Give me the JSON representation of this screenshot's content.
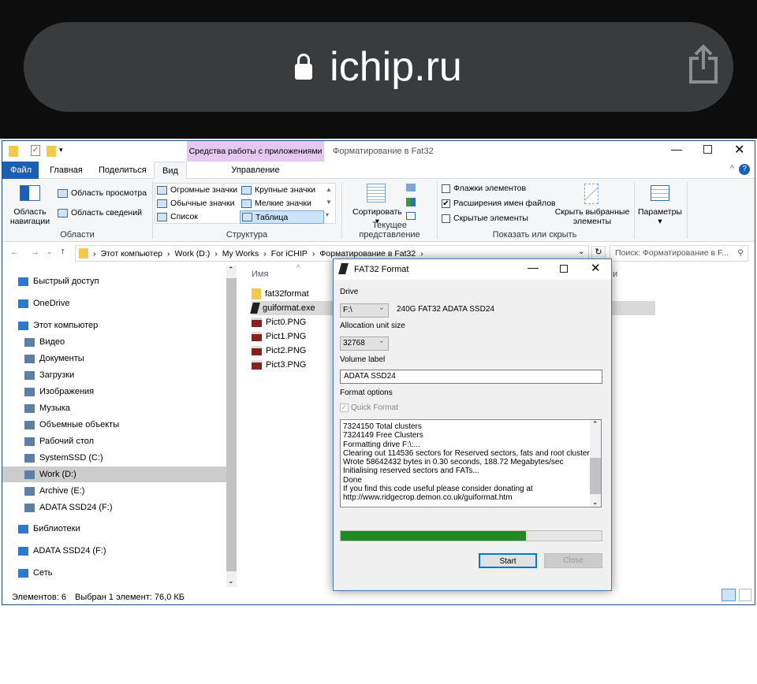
{
  "browser": {
    "domain": "ichip.ru",
    "icons": [
      "lock-icon",
      "share-icon"
    ]
  },
  "explorer": {
    "window_title": "Форматирование в Fat32",
    "context_tab_group": "Средства работы с приложениями",
    "tabs": [
      "Файл",
      "Главная",
      "Поделиться",
      "Вид",
      "Управление"
    ],
    "ribbon": {
      "areas": {
        "nav_pane": "Область навигации",
        "preview": "Область просмотра",
        "details": "Область сведений",
        "group": "Области"
      },
      "layout": {
        "items": [
          "Огромные значки",
          "Крупные значки",
          "Обычные значки",
          "Мелкие значки",
          "Список",
          "Таблица"
        ],
        "selected": "Таблица",
        "group": "Структура"
      },
      "current_view": {
        "sort": "Сортировать",
        "group": "Текущее представление"
      },
      "show_hide": {
        "checkboxes": [
          {
            "label": "Флажки элементов",
            "checked": false
          },
          {
            "label": "Расширения имен файлов",
            "checked": true
          },
          {
            "label": "Скрытые элементы",
            "checked": false
          }
        ],
        "hide_selected": "Скрыть выбранные элементы",
        "group": "Показать или скрыть"
      },
      "options": "Параметры"
    },
    "breadcrumb": [
      "Этот компьютер",
      "Work (D:)",
      "My Works",
      "For iCHIP",
      "Форматирование в Fat32"
    ],
    "search_placeholder": "Поиск: Форматирование в F...",
    "nav": [
      {
        "label": "Быстрый доступ",
        "level": 0
      },
      {
        "label": "OneDrive",
        "level": 0
      },
      {
        "label": "Этот компьютер",
        "level": 0
      },
      {
        "label": "Видео",
        "level": 1
      },
      {
        "label": "Документы",
        "level": 1
      },
      {
        "label": "Загрузки",
        "level": 1
      },
      {
        "label": "Изображения",
        "level": 1
      },
      {
        "label": "Музыка",
        "level": 1
      },
      {
        "label": "Объемные объекты",
        "level": 1
      },
      {
        "label": "Рабочий стол",
        "level": 1
      },
      {
        "label": "SystemSSD (C:)",
        "level": 1
      },
      {
        "label": "Work (D:)",
        "level": 1,
        "selected": true
      },
      {
        "label": "Archive (E:)",
        "level": 1
      },
      {
        "label": "ADATA SSD24 (F:)",
        "level": 1
      },
      {
        "label": "Библиотеки",
        "level": 0
      },
      {
        "label": "ADATA SSD24 (F:)",
        "level": 0
      },
      {
        "label": "Сеть",
        "level": 0
      }
    ],
    "column_name": "Имя",
    "column_partial": "и",
    "files": [
      {
        "name": "fat32format",
        "type": "folder"
      },
      {
        "name": "guiformat.exe",
        "type": "exe",
        "selected": true
      },
      {
        "name": "Pict0.PNG",
        "type": "png"
      },
      {
        "name": "Pict1.PNG",
        "type": "png"
      },
      {
        "name": "Pict2.PNG",
        "type": "png"
      },
      {
        "name": "Pict3.PNG",
        "type": "png"
      }
    ],
    "status": {
      "count": "Элементов: 6",
      "selection": "Выбран 1 элемент: 76,0 КБ"
    }
  },
  "dialog": {
    "title": "FAT32 Format",
    "drive_label": "Drive",
    "drive_value": "F:\\",
    "drive_info": "240G FAT32 ADATA SSD24",
    "alloc_label": "Allocation unit size",
    "alloc_value": "32768",
    "volume_label": "Volume label",
    "volume_value": "ADATA SSD24",
    "options_label": "Format options",
    "quick_format": "Quick Format",
    "quick_checked": true,
    "log": [
      "7324150 Total clusters",
      "7324149 Free Clusters",
      "Formatting drive F:\\:...",
      "Clearing out 114536 sectors for Reserved sectors, fats and root cluster...",
      "Wrote 58642432 bytes in 0.30 seconds, 188.72 Megabytes/sec",
      "Initialising reserved sectors and FATs...",
      "Done",
      "If you find this code useful please consider donating at",
      "http://www.ridgecrop.demon.co.uk/guiformat.htm"
    ],
    "progress": 0.71,
    "progress_color": "#1f8a1f",
    "start": "Start",
    "close": "Close"
  }
}
